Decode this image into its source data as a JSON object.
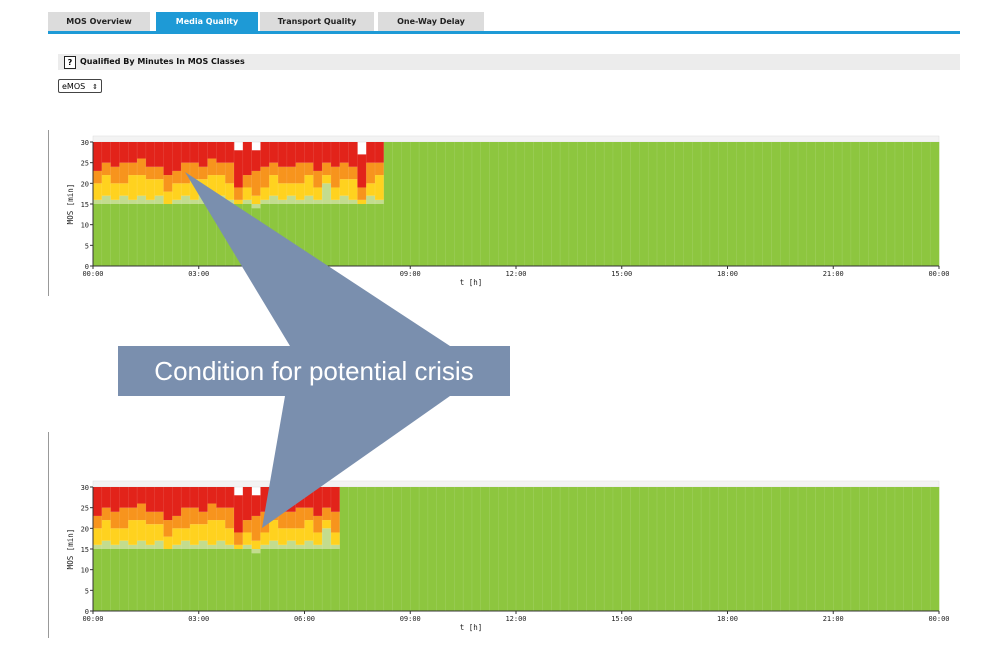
{
  "tabs": [
    {
      "label": "MOS Overview",
      "active": false
    },
    {
      "label": "Media Quality",
      "active": true
    },
    {
      "label": "Transport Quality",
      "active": false
    },
    {
      "label": "One-Way Delay",
      "active": false
    }
  ],
  "section": {
    "help_label": "?",
    "title": "Qualified By Minutes In MOS Classes"
  },
  "mos_selector": {
    "value": "eMOS",
    "arrow": "⇕"
  },
  "callout": {
    "text": "Condition for potential crisis"
  },
  "colors": {
    "green": "#8dc63f",
    "light_green": "#c3dc8e",
    "yellow": "#ffd21f",
    "orange": "#f7941d",
    "red": "#e2231a",
    "tab_accent": "#1e9ad6",
    "callout": "#7a8fae"
  },
  "chart_data": [
    {
      "type": "bar",
      "stacked": true,
      "ylabel": "MOS [min]",
      "xlabel": "t [h]",
      "ylim": [
        0,
        30
      ],
      "yticks": [
        0,
        5,
        10,
        15,
        20,
        25,
        30
      ],
      "xtick_labels": [
        "00:00",
        "03:00",
        "06:00",
        "09:00",
        "12:00",
        "15:00",
        "18:00",
        "21:00",
        "00:00"
      ],
      "bins": 96,
      "degraded_bins": 33,
      "series_names": [
        "green",
        "light_green",
        "yellow",
        "orange",
        "red"
      ],
      "degraded_profile": [
        [
          15,
          1,
          4,
          3,
          7
        ],
        [
          15,
          2,
          5,
          3,
          5
        ],
        [
          15,
          1,
          4,
          4,
          6
        ],
        [
          15,
          2,
          3,
          5,
          5
        ],
        [
          15,
          1,
          6,
          3,
          5
        ],
        [
          15,
          2,
          5,
          4,
          4
        ],
        [
          15,
          1,
          5,
          3,
          6
        ],
        [
          15,
          2,
          4,
          3,
          6
        ],
        [
          15,
          0,
          3,
          4,
          8
        ],
        [
          15,
          1,
          4,
          3,
          7
        ],
        [
          15,
          2,
          3,
          5,
          5
        ],
        [
          15,
          1,
          5,
          4,
          5
        ],
        [
          15,
          2,
          4,
          3,
          6
        ],
        [
          15,
          1,
          6,
          4,
          4
        ],
        [
          15,
          2,
          5,
          3,
          5
        ],
        [
          15,
          1,
          4,
          5,
          5
        ],
        [
          15,
          0,
          1,
          3,
          9
        ],
        [
          15,
          1,
          3,
          3,
          8
        ],
        [
          14,
          1,
          2,
          6,
          5
        ],
        [
          15,
          1,
          3,
          5,
          6
        ],
        [
          15,
          2,
          5,
          3,
          5
        ],
        [
          15,
          1,
          4,
          4,
          6
        ],
        [
          15,
          2,
          3,
          4,
          6
        ],
        [
          15,
          1,
          4,
          5,
          5
        ],
        [
          15,
          2,
          5,
          3,
          5
        ],
        [
          15,
          1,
          3,
          4,
          7
        ],
        [
          15,
          5,
          2,
          3,
          5
        ],
        [
          15,
          1,
          3,
          5,
          6
        ],
        [
          15,
          2,
          4,
          4,
          5
        ],
        [
          15,
          1,
          5,
          3,
          6
        ],
        [
          15,
          0,
          1,
          3,
          8
        ],
        [
          15,
          2,
          3,
          5,
          5
        ],
        [
          15,
          1,
          6,
          3,
          5
        ]
      ]
    },
    {
      "type": "bar",
      "stacked": true,
      "ylabel": "MOS [min]",
      "xlabel": "t [h]",
      "ylim": [
        0,
        30
      ],
      "yticks": [
        0,
        5,
        10,
        15,
        20,
        25,
        30
      ],
      "xtick_labels": [
        "00:00",
        "03:00",
        "06:00",
        "09:00",
        "12:00",
        "15:00",
        "18:00",
        "21:00",
        "00:00"
      ],
      "bins": 96,
      "degraded_bins": 28,
      "series_names": [
        "green",
        "light_green",
        "yellow",
        "orange",
        "red"
      ],
      "degraded_profile": [
        [
          15,
          1,
          4,
          3,
          7
        ],
        [
          15,
          2,
          5,
          3,
          5
        ],
        [
          15,
          1,
          4,
          4,
          6
        ],
        [
          15,
          2,
          3,
          5,
          5
        ],
        [
          15,
          1,
          6,
          3,
          5
        ],
        [
          15,
          2,
          5,
          4,
          4
        ],
        [
          15,
          1,
          5,
          3,
          6
        ],
        [
          15,
          2,
          4,
          3,
          6
        ],
        [
          15,
          0,
          3,
          4,
          8
        ],
        [
          15,
          1,
          4,
          3,
          7
        ],
        [
          15,
          2,
          3,
          5,
          5
        ],
        [
          15,
          1,
          5,
          4,
          5
        ],
        [
          15,
          2,
          4,
          3,
          6
        ],
        [
          15,
          1,
          6,
          4,
          4
        ],
        [
          15,
          2,
          5,
          3,
          5
        ],
        [
          15,
          1,
          4,
          5,
          5
        ],
        [
          15,
          0,
          1,
          3,
          9
        ],
        [
          15,
          1,
          3,
          3,
          8
        ],
        [
          14,
          1,
          2,
          6,
          5
        ],
        [
          15,
          1,
          3,
          5,
          6
        ],
        [
          15,
          2,
          5,
          3,
          5
        ],
        [
          15,
          1,
          4,
          4,
          6
        ],
        [
          15,
          2,
          3,
          4,
          6
        ],
        [
          15,
          1,
          4,
          5,
          5
        ],
        [
          15,
          2,
          5,
          3,
          5
        ],
        [
          15,
          1,
          3,
          4,
          7
        ],
        [
          15,
          5,
          2,
          3,
          5
        ],
        [
          15,
          1,
          3,
          5,
          6
        ]
      ]
    }
  ]
}
